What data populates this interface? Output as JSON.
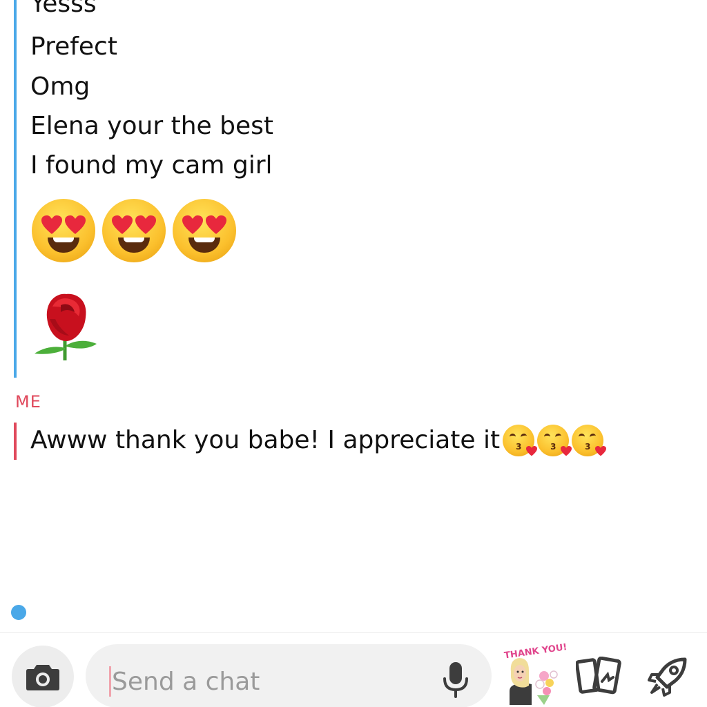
{
  "friend_messages": {
    "lines": [
      "Yesss",
      "Prefect",
      "Omg",
      "Elena your the best",
      "I found my cam girl"
    ],
    "emoji_row": [
      "smiling-face-with-heart-eyes",
      "smiling-face-with-heart-eyes",
      "smiling-face-with-heart-eyes"
    ],
    "sticker": "rose",
    "bar_color": "#4aa8e8"
  },
  "me_message": {
    "sender_label": "ME",
    "text": "Awww thank you babe! I appreciate it",
    "trailing_emojis": [
      "face-blowing-a-kiss",
      "face-blowing-a-kiss",
      "face-blowing-a-kiss"
    ],
    "label_color": "#e0495c"
  },
  "typing_indicator_color": "#4aa8e8",
  "composer": {
    "placeholder": "Send a chat",
    "camera_icon": "camera-icon",
    "mic_icon": "microphone-icon",
    "bitmoji_label": "THANK YOU!",
    "games_icon": "cards-icon",
    "rocket_icon": "rocket-icon"
  }
}
